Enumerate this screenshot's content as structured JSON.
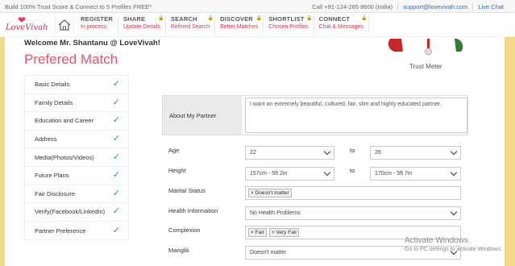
{
  "topbar": {
    "promo": "Build 100% Trust Score & Connect to 5 Profiles FREE*",
    "phone": "Call +91-124-265 8600 (India)",
    "email": "support@lovevivah.com",
    "chat": "Live Chat"
  },
  "logo": {
    "text": "LoveVivah"
  },
  "nav": [
    {
      "title": "REGISTER",
      "sub": "In process"
    },
    {
      "title": "SHARE",
      "sub": "Update Details"
    },
    {
      "title": "SEARCH",
      "sub": "Refined Search"
    },
    {
      "title": "DISCOVER",
      "sub": "Better Matches"
    },
    {
      "title": "SHORTLIST",
      "sub": "Chosen Profiles"
    },
    {
      "title": "CONNECT",
      "sub": "Chat & Messages"
    }
  ],
  "welcome": "Welcome Mr. Shantanu @ LoveVivah!",
  "page_title": "Prefered Match",
  "trust_meter_label": "Trust Meter",
  "sidebar": [
    "Basic Details",
    "Family Details",
    "Education and Career",
    "Address",
    "Media(Photos/Videos)",
    "Future Plans",
    "Fair Disclosure",
    "Verify(Facebook/LinkedIn)",
    "Partner Preference"
  ],
  "form": {
    "about_label": "About My Partner",
    "about_value": "I want an extremely beautiful, cultured, fair, slim and highly educated partner.",
    "age_label": "Age",
    "age_from": "22",
    "age_to": "26",
    "to_label": "to",
    "height_label": "Height",
    "height_from": "157cm - 5ft 2in",
    "height_to": "170cm - 5ft 7in",
    "marital_label": "Marital Status",
    "marital_tags": [
      "Doesn't matter"
    ],
    "health_label": "Health Information",
    "health_value": "No Health Problems",
    "complexion_label": "Complexion",
    "complexion_tags": [
      "Fair",
      "Very Fair"
    ],
    "manglik_label": "Manglik",
    "manglik_value": "Doesn't matter"
  },
  "watermark": {
    "line1": "Activate Windows",
    "line2": "Go to PC settings to activate Windows."
  }
}
